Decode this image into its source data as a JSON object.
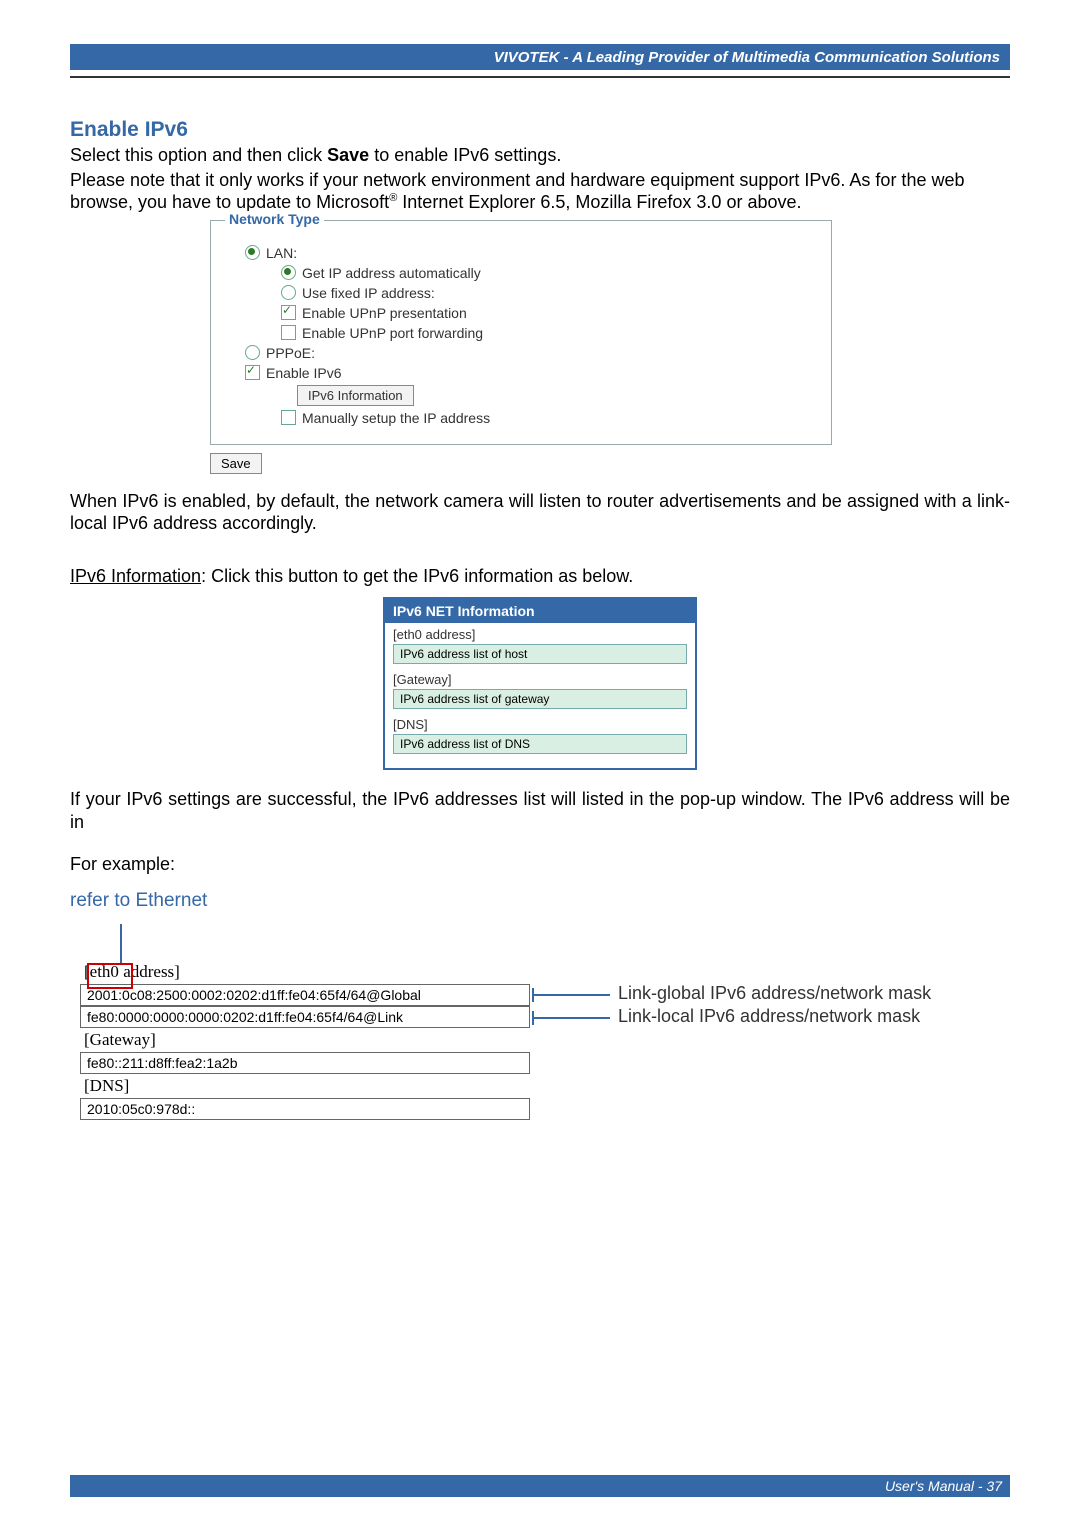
{
  "header": {
    "brand": "VIVOTEK - A Leading Provider of Multimedia Communication Solutions"
  },
  "section": {
    "title": "Enable IPv6",
    "p1a": "Select this option and then click ",
    "p1b": "Save",
    "p1c": " to enable IPv6 settings.",
    "p2a": "Please note that it only works if your network environment and hardware equipment support IPv6. As for the web browse, you have to update to Microsoft",
    "p2_sup": "®",
    "p2b": " Internet Explorer 6.5, Mozilla Firefox 3.0 or above."
  },
  "network_type": {
    "legend": "Network Type",
    "lan": "LAN:",
    "auto_ip": "Get IP address automatically",
    "fixed_ip": "Use fixed IP address:",
    "upnp_pres": "Enable UPnP presentation",
    "upnp_port": "Enable UPnP port forwarding",
    "pppoe": "PPPoE:",
    "enable_ipv6": "Enable IPv6",
    "ipv6_info_btn": "IPv6 Information",
    "manual_ip": "Manually setup the IP address",
    "save_btn": "Save"
  },
  "after_fieldset": {
    "p": "When IPv6 is enabled, by default, the network camera will listen to router advertisements and be assigned with a link-local IPv6 address accordingly.",
    "info_label": "IPv6 Information",
    "info_desc": ": Click this button to get the IPv6 information as below."
  },
  "popup": {
    "title": "IPv6 NET Information",
    "eth_lbl": "[eth0 address]",
    "eth_val": "IPv6 address list of host",
    "gw_lbl": "[Gateway]",
    "gw_val": "IPv6 address list of gateway",
    "dns_lbl": "[DNS]",
    "dns_val": "IPv6 address list of DNS"
  },
  "after_popup": {
    "p": "If your IPv6 settings are successful, the IPv6 addresses list will listed in the pop-up window. The IPv6 address will be in",
    "for_example": "For example:",
    "refer": "refer to Ethernet"
  },
  "example": {
    "eth_lbl_a": "[eth0",
    "eth_lbl_b": " address]",
    "global_addr": "2001:0c08:2500:0002:0202:d1ff:fe04:65f4/64@Global",
    "link_addr": "fe80:0000:0000:0000:0202:d1ff:fe04:65f4/64@Link",
    "global_note": "Link-global IPv6 address/network mask",
    "local_note": "Link-local IPv6 address/network mask",
    "gw_lbl": "[Gateway]",
    "gw_val": "fe80::211:d8ff:fea2:1a2b",
    "dns_lbl": "[DNS]",
    "dns_val": "2010:05c0:978d::"
  },
  "footer": {
    "text": "User's Manual - 37"
  }
}
